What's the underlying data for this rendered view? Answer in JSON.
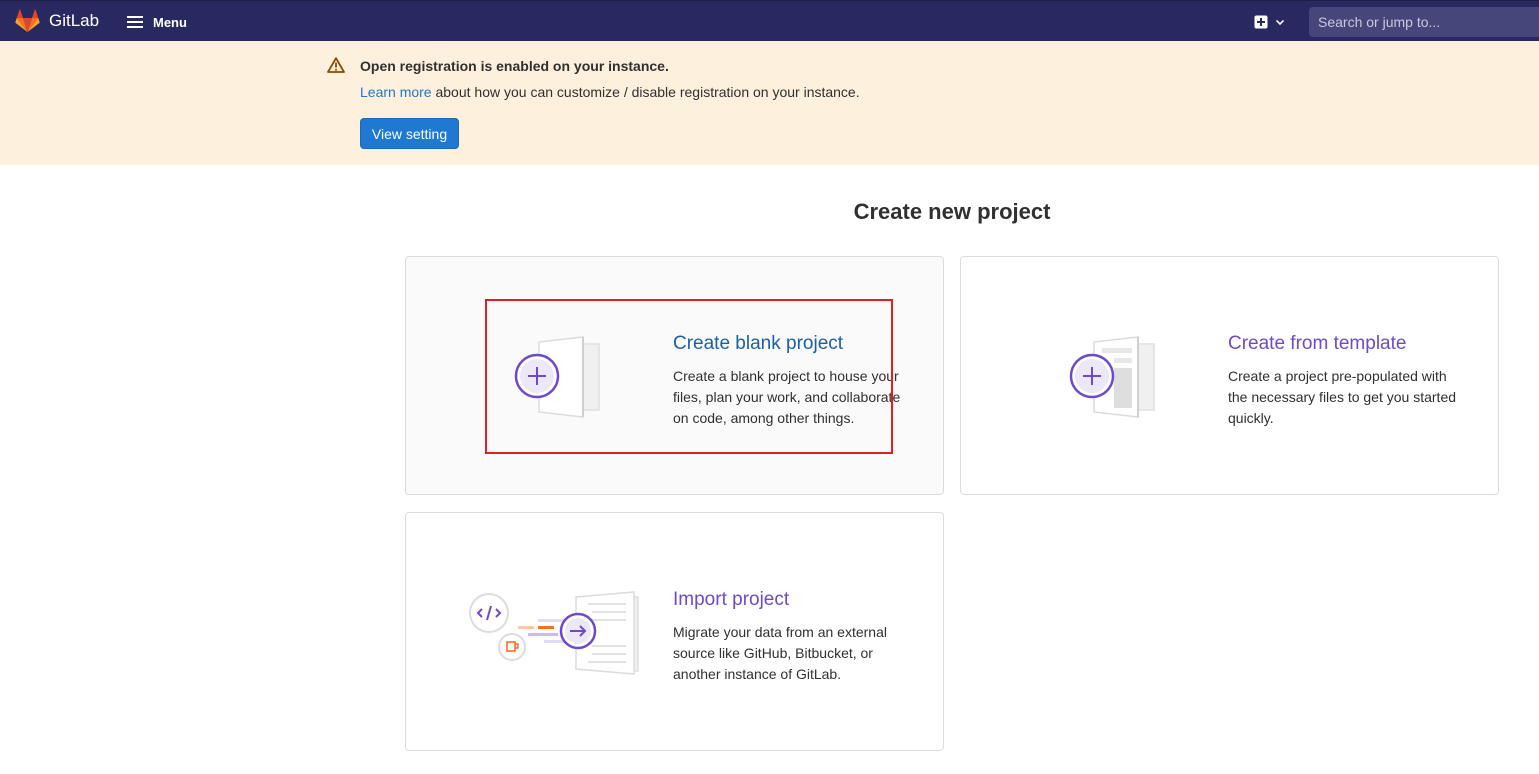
{
  "navbar": {
    "logo_text": "GitLab",
    "menu_label": "Menu",
    "search_placeholder": "Search or jump to..."
  },
  "banner": {
    "title": "Open registration is enabled on your instance.",
    "link_text": "Learn more",
    "text_rest": " about how you can customize / disable registration on your instance.",
    "button_label": "View setting"
  },
  "page": {
    "title": "Create new project"
  },
  "panels": [
    {
      "title": "Create blank project",
      "description": "Create a blank project to house your files, plan your work, and collaborate on code, among other things."
    },
    {
      "title": "Create from template",
      "description": "Create a project pre-populated with the necessary files to get you started quickly."
    },
    {
      "title": "Import project",
      "description": "Migrate your data from an external source like GitHub, Bitbucket, or another instance of GitLab."
    }
  ],
  "colors": {
    "navbar": "#292961",
    "banner": "#fdf1dd",
    "primary_button": "#1f78d1",
    "panel_title": "#6e49cb",
    "highlight_box": "#e02020"
  },
  "icons": [
    "gitlab-logo-icon",
    "hamburger-icon",
    "plus-square-icon",
    "chevron-down-icon",
    "warning-icon",
    "blank-project-illustration",
    "template-illustration",
    "import-illustration"
  ]
}
